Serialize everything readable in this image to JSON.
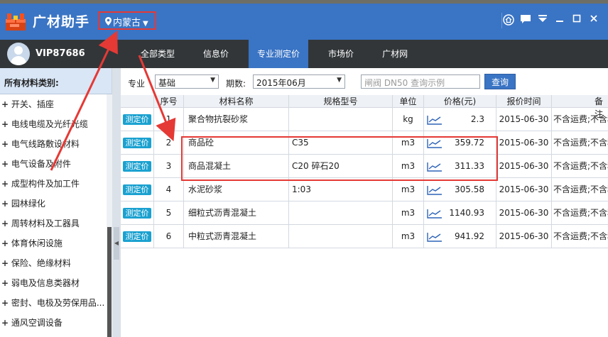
{
  "app": {
    "title": "广材助手",
    "region": "内蒙古"
  },
  "user": {
    "name": "VIP87686"
  },
  "nav": {
    "tabs": [
      "全部类型",
      "信息价",
      "专业测定价",
      "市场价",
      "广材网"
    ],
    "active_index": 2
  },
  "sidebar": {
    "header": "所有材料类别:",
    "items": [
      "开关、插座",
      "电线电缆及光纤光缆",
      "电气线路敷设材料",
      "电气设备及附件",
      "成型构件及加工件",
      "园林绿化",
      "周转材料及工器具",
      "体育休闲设施",
      "保险、绝缘材料",
      "弱电及信息类器材",
      "密封、电极及劳保用品...",
      "通风空调设备"
    ]
  },
  "filter": {
    "specialty_label": "专业",
    "specialty_value": "基础",
    "period_label": "期数:",
    "period_value": "2015年06月",
    "search_placeholder": "闸阀 DN50 查询示例",
    "search_button": "查询"
  },
  "table": {
    "headers": [
      "序号",
      "材料名称",
      "规格型号",
      "单位",
      "价格(元)",
      "报价时间",
      "备注"
    ],
    "badge_label": "测定价",
    "rows": [
      {
        "index": "1",
        "name": "聚合物抗裂砂浆",
        "spec": "",
        "unit": "kg",
        "price": "2.3",
        "date": "2015-06-30",
        "note": "不含运费;不含税"
      },
      {
        "index": "2",
        "name": "商品砼",
        "spec": "C35",
        "unit": "m3",
        "price": "359.72",
        "date": "2015-06-30",
        "note": "不含运费;不含税"
      },
      {
        "index": "3",
        "name": "商品混凝土",
        "spec": "C20 碎石20",
        "unit": "m3",
        "price": "311.33",
        "date": "2015-06-30",
        "note": "不含运费;不含税"
      },
      {
        "index": "4",
        "name": "水泥砂浆",
        "spec": "1:03",
        "unit": "m3",
        "price": "305.58",
        "date": "2015-06-30",
        "note": "不含运费;不含税"
      },
      {
        "index": "5",
        "name": "细粒式沥青混凝土",
        "spec": "",
        "unit": "m3",
        "price": "1140.93",
        "date": "2015-06-30",
        "note": "不含运费;不含税"
      },
      {
        "index": "6",
        "name": "中粒式沥青混凝土",
        "spec": "",
        "unit": "m3",
        "price": "941.92",
        "date": "2015-06-30",
        "note": "不含运费;不含税"
      }
    ]
  },
  "icons": {
    "trend": "line-chart-icon",
    "pin": "location-pin-icon"
  },
  "colors": {
    "accent": "#3a74c4",
    "badge": "#1aa1d0",
    "annotation": "#e53935",
    "nav": "#323639"
  }
}
